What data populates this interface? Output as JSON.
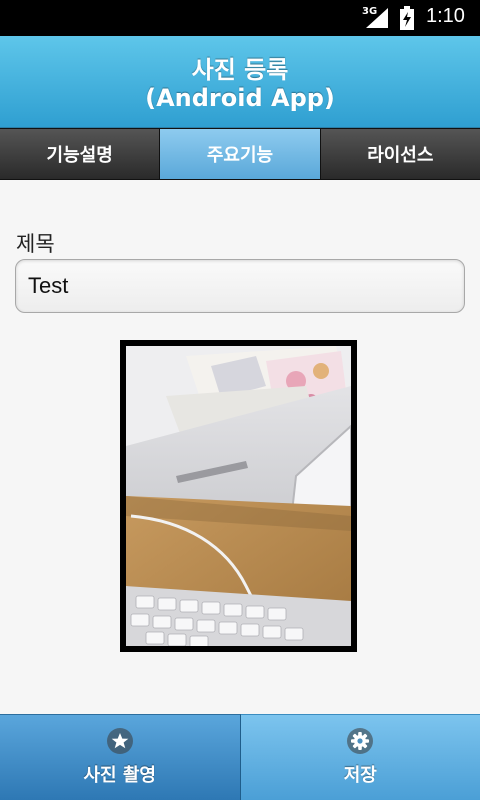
{
  "status_bar": {
    "network": "3G",
    "time": "1:10",
    "icons": [
      "signal-icon",
      "battery-icon"
    ]
  },
  "header": {
    "title_line1": "사진 등록",
    "title_line2": "(Android App)"
  },
  "tabs": [
    {
      "label": "기능설명",
      "active": false
    },
    {
      "label": "주요기능",
      "active": true
    },
    {
      "label": "라이선스",
      "active": false
    }
  ],
  "form": {
    "title_label": "제목",
    "title_value": "Test"
  },
  "bottom_bar": {
    "capture_label": "사진 촬영",
    "capture_icon": "star-icon",
    "save_label": "저장",
    "save_icon": "gear-icon"
  },
  "colors": {
    "header": "#3aa9d8",
    "active_tab": "#6fb7e3",
    "inactive_tab": "#3a3a3a"
  }
}
